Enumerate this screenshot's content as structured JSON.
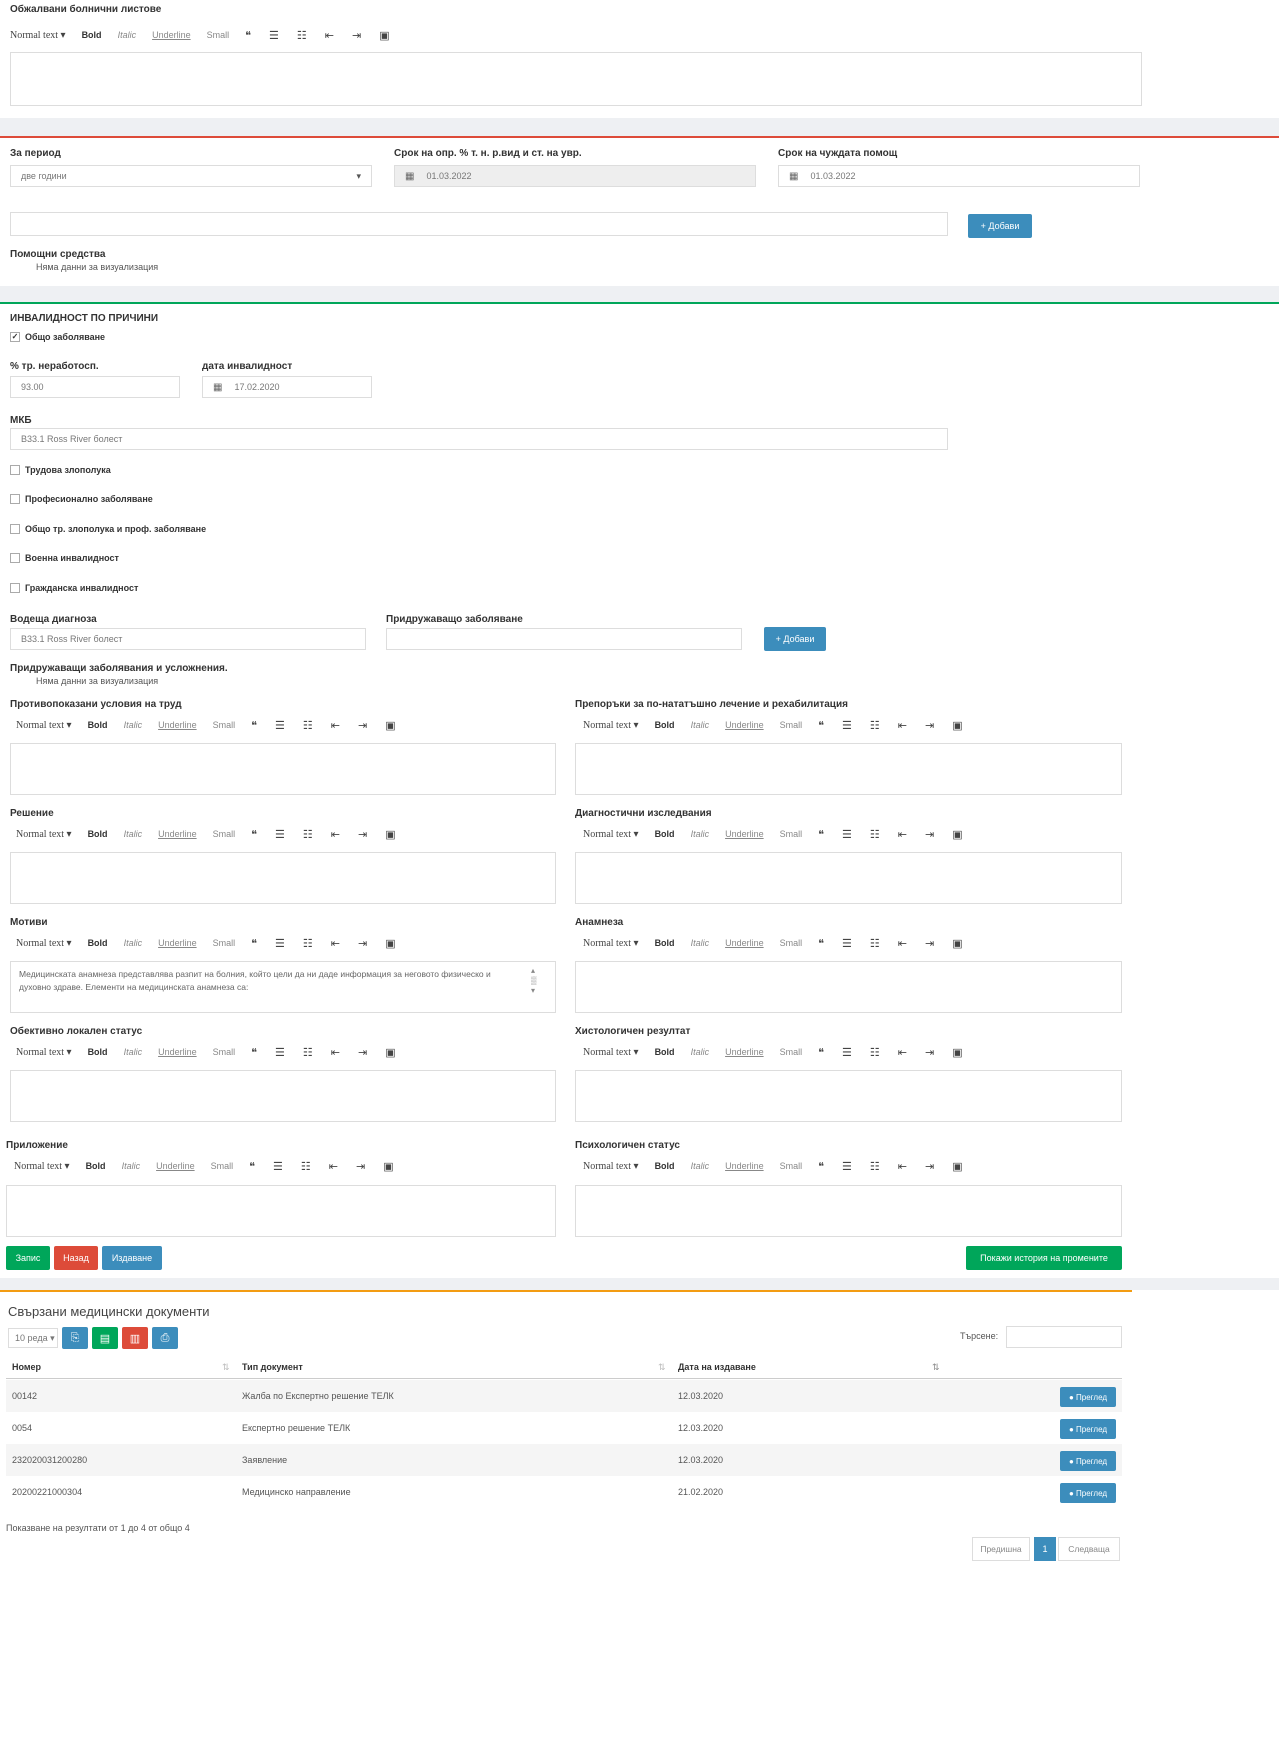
{
  "toolbar": {
    "normal_text": "Normal text ▾",
    "bold": "Bold",
    "italic": "Italic",
    "underline": "Underline",
    "small": "Small",
    "quote": "❝",
    "ul": "☰",
    "ol": "☷",
    "outdent": "⇤",
    "indent": "⇥",
    "image": "▣"
  },
  "sick_leave": {
    "label": "Обжалвани болнични листове"
  },
  "period": {
    "label": "За период",
    "value": "две години",
    "term_label": "Срок на опр. % т. н. р.вид и ст. на увр.",
    "term_value": "01.03.2022",
    "help_label": "Срок на чуждата помощ",
    "help_value": "01.03.2022",
    "add_button": "+ Добави",
    "aids_label": "Помощни средства",
    "aids_nodata": "Няма данни за визуализация"
  },
  "disability": {
    "section_title": "ИНВАЛИДНОСТ ПО ПРИЧИНИ",
    "general_disease": "Общо заболяване",
    "percent_label": "% тр. неработосп.",
    "percent_value": "93.00",
    "date_label": "дата инвалидност",
    "date_value": "17.02.2020",
    "mkb_label": "МКБ",
    "mkb_value": "B33.1 Ross River болест",
    "causes": [
      "Трудова злополука",
      "Професионално заболяване",
      "Общо тр. злополука и проф. заболяване",
      "Военна инвалидност",
      "Гражданска инвалидност"
    ],
    "leading_label": "Водеща диагноза",
    "leading_value": "B33.1 Ross River болест",
    "concomitant_label": "Придружаващо заболяване",
    "add_button": "+ Добави",
    "complications_label": "Придружаващи заболявания и усложнения.",
    "complications_nodata": "Няма данни за визуализация"
  },
  "editors": {
    "contraindicated": "Противопоказани условия на труд",
    "recommendations": "Препоръки за по-нататъшно лечение и рехабилитация",
    "decision": "Решение",
    "diagnostics": "Диагностични изследвания",
    "motive": "Мотиви",
    "motive_text": "Медицинската анамнеза представлява разпит на болния, който цели да ни даде информация за неговото физическо и духовно здраве. Елементи на медицинската анамнеза са:",
    "anamnesis": "Анамнеза",
    "objective": "Обективно локален статус",
    "histology": "Хистологичен резултат",
    "appendix": "Приложение",
    "psych": "Психологичен статус"
  },
  "actions": {
    "save": "Запис",
    "back": "Назад",
    "issue": "Издаване",
    "history": "Покажи история на промените"
  },
  "documents": {
    "title": "Свързани медицински документи",
    "page_size": "10 реда ▾",
    "export_icons": [
      "⎘",
      "▤",
      "▥",
      "⎙"
    ],
    "search_label": "Търсене:",
    "columns": [
      "Номер",
      "Тип документ",
      "Дата на издаване"
    ],
    "rows": [
      {
        "num": "00142",
        "type": "Жалба по Експертно решение ТЕЛК",
        "date": "12.03.2020",
        "action": "● Преглед"
      },
      {
        "num": "0054",
        "type": "Експертно решение ТЕЛК",
        "date": "12.03.2020",
        "action": "● Преглед"
      },
      {
        "num": "232020031200280",
        "type": "Заявление",
        "date": "12.03.2020",
        "action": "● Преглед"
      },
      {
        "num": "20200221000304",
        "type": "Медицинско направление",
        "date": "21.02.2020",
        "action": "● Преглед"
      }
    ],
    "info": "Показване на резултати от 1 до 4 от общо 4",
    "prev": "Предишна",
    "page": "1",
    "next": "Следваща"
  },
  "colors": {
    "accent_red": "#dd4b39",
    "accent_green": "#00a65a",
    "accent_blue": "#3c8dbc",
    "rule_orange": "#f39c12"
  }
}
